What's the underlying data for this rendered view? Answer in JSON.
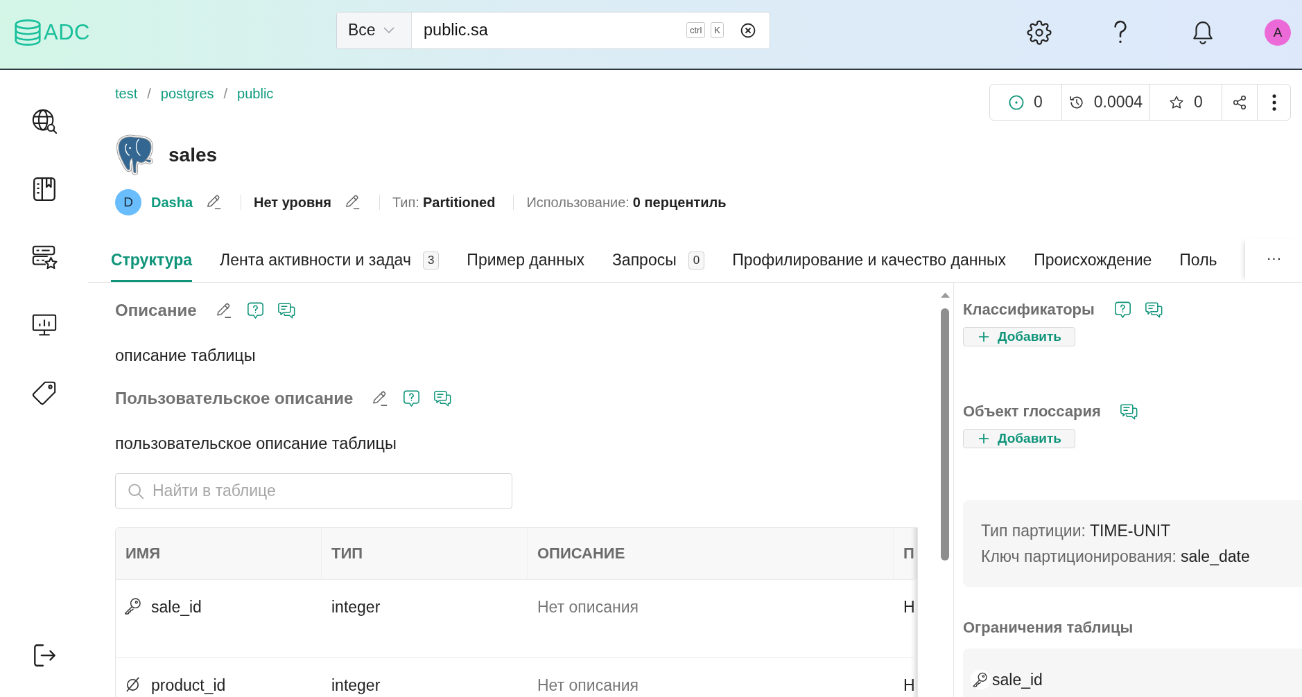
{
  "header": {
    "logo": "ADC",
    "search": {
      "scope": "Все",
      "value": "public.sa",
      "shortcut_keys": [
        "ctrl",
        "K"
      ]
    },
    "user_initial": "A"
  },
  "breadcrumbs": {
    "items": [
      "test",
      "postgres",
      "public"
    ],
    "separator": "/"
  },
  "stats": [
    {
      "kind": "watchers",
      "value": "0"
    },
    {
      "kind": "usage_history",
      "value": "0.0004"
    },
    {
      "kind": "favorites",
      "value": "0"
    }
  ],
  "title": "sales",
  "meta": {
    "owner": {
      "initial": "D",
      "name": "Dasha"
    },
    "level": "Нет уровня",
    "type": {
      "label": "Тип:",
      "value": "Partitioned"
    },
    "usage": {
      "label": "Использование:",
      "value": "0 перцентиль"
    }
  },
  "tabs": [
    {
      "label": "Структура",
      "selected": true
    },
    {
      "label": "Лента активности и задач",
      "count": "3",
      "selected": false
    },
    {
      "label": "Пример данных",
      "selected": false
    },
    {
      "label": "Запросы",
      "count": "0",
      "selected": false
    },
    {
      "label": "Профилирование и качество данных",
      "selected": false
    },
    {
      "label": "Происхождение",
      "selected": false
    },
    {
      "label": "Поль",
      "selected": false
    }
  ],
  "tabs_more": "···",
  "description": {
    "title": "Описание",
    "text": "описание таблицы"
  },
  "user_description": {
    "title": "Пользовательское описание",
    "text": "пользовательское описание таблицы"
  },
  "table_search": {
    "placeholder": "Найти в таблице"
  },
  "table": {
    "columns": [
      "ИМЯ",
      "ТИП",
      "ОПИСАНИЕ",
      "П"
    ],
    "rows": [
      {
        "kind": "primary_key",
        "cells": [
          "sale_id",
          "integer",
          "Нет описания",
          "Н"
        ]
      },
      {
        "kind": "nullable",
        "cells": [
          "product_id",
          "integer",
          "Нет описания",
          "Н"
        ]
      }
    ]
  },
  "classifiers": {
    "title": "Классификаторы",
    "add_button": "Добавить"
  },
  "glossary": {
    "title": "Объект глоссария",
    "add_button": "Добавить"
  },
  "partition": [
    {
      "label": "Тип партиции:",
      "value": "TIME-UNIT"
    },
    {
      "label": "Ключ партиционирования:",
      "value": "sale_date"
    }
  ],
  "constraints": {
    "title": "Ограничения таблицы",
    "items": [
      {
        "kind": "primary_key",
        "column": "sale_id"
      }
    ]
  }
}
